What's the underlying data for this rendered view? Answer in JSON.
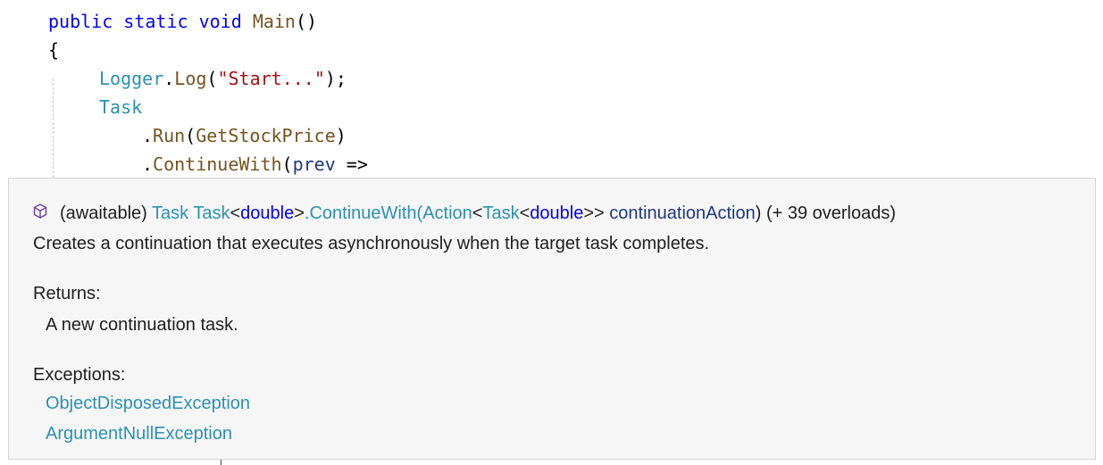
{
  "code": {
    "line1": {
      "public": "public",
      "static": "static",
      "void": "void",
      "method": "Main",
      "parens": "()"
    },
    "line2": {
      "brace": "{"
    },
    "line3": {
      "logger": "Logger",
      "dot": ".",
      "log": "Log",
      "open": "(",
      "string": "\"Start...\"",
      "close": ");"
    },
    "line4": {
      "task": "Task"
    },
    "line5": {
      "dot": ".",
      "run": "Run",
      "open": "(",
      "arg": "GetStockPrice",
      "close": ")"
    },
    "line6": {
      "dot": ".",
      "continue": "ContinueWith",
      "open": "(",
      "param": "prev",
      "arrow": " =>"
    }
  },
  "tooltip": {
    "icon": "method-cube-icon",
    "signature": {
      "prefix": "(awaitable) ",
      "ret_type": "Task",
      "space1": " ",
      "owner_type": "Task",
      "lt1": "<",
      "generic_kw": "double",
      "gt1": ">",
      "dot_method": ".ContinueWith(",
      "action_type": "Action",
      "lt2": "<",
      "inner_task": "Task",
      "lt3": "<",
      "inner_kw": "double",
      "gt_close": ">>",
      "space2": " ",
      "param_name": "continuationAction",
      "suffix": ") (+ 39 overloads)"
    },
    "description": "Creates a continuation that executes asynchronously when the target task completes.",
    "returns_label": "Returns:",
    "returns_value": "A new continuation task.",
    "exceptions_label": "Exceptions:",
    "exceptions": [
      "ObjectDisposedException",
      "ArgumentNullException"
    ]
  },
  "colors": {
    "keyword": "#0000ff",
    "method": "#74531f",
    "type": "#2b91af",
    "string": "#a31515",
    "parameter": "#1f377f",
    "tooltip_bg": "#f6f6f7",
    "icon": "#6b3fa0"
  }
}
